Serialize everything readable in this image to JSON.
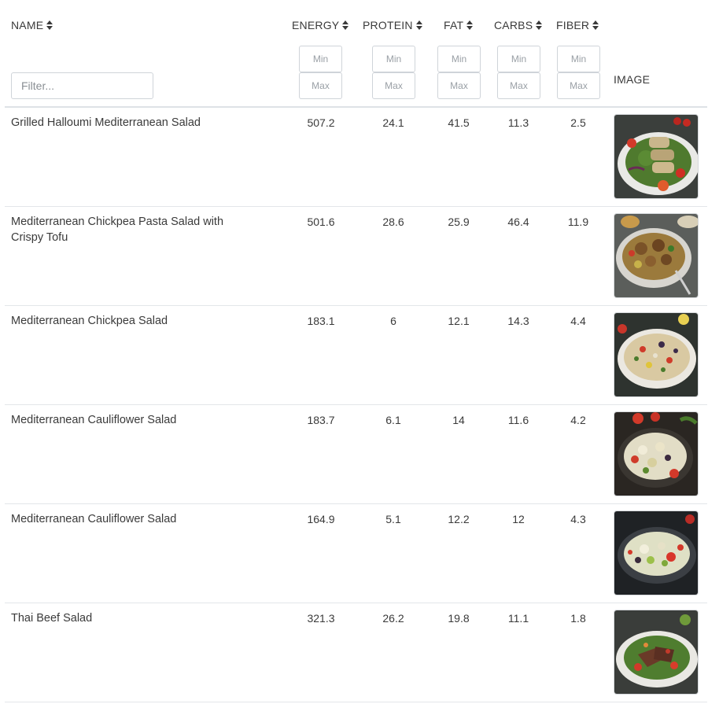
{
  "columns": {
    "name": "NAME",
    "energy": "ENERGY",
    "protein": "PROTEIN",
    "fat": "FAT",
    "carbs": "CARBS",
    "fiber": "FIBER",
    "image": "IMAGE"
  },
  "filter": {
    "placeholder": "Filter...",
    "value": ""
  },
  "range_filters": {
    "min_placeholder": "Min",
    "max_placeholder": "Max"
  },
  "icons": {
    "sort": "sort-up-down-icon"
  },
  "rows": [
    {
      "name": "Grilled Halloumi Mediterranean Salad",
      "energy": "507.2",
      "protein": "24.1",
      "fat": "41.5",
      "carbs": "11.3",
      "fiber": "2.5",
      "image": "salad-photo-halloumi"
    },
    {
      "name": "Mediterranean Chickpea Pasta Salad with Crispy Tofu",
      "energy": "501.6",
      "protein": "28.6",
      "fat": "25.9",
      "carbs": "46.4",
      "fiber": "11.9",
      "image": "salad-photo-chickpea-pasta"
    },
    {
      "name": "Mediterranean Chickpea Salad",
      "energy": "183.1",
      "protein": "6",
      "fat": "12.1",
      "carbs": "14.3",
      "fiber": "4.4",
      "image": "salad-photo-chickpea"
    },
    {
      "name": "Mediterranean Cauliflower Salad",
      "energy": "183.7",
      "protein": "6.1",
      "fat": "14",
      "carbs": "11.6",
      "fiber": "4.2",
      "image": "salad-photo-cauliflower"
    },
    {
      "name": "Mediterranean Cauliflower Salad",
      "energy": "164.9",
      "protein": "5.1",
      "fat": "12.2",
      "carbs": "12",
      "fiber": "4.3",
      "image": "salad-photo-cauliflower"
    },
    {
      "name": "Thai Beef Salad",
      "energy": "321.3",
      "protein": "26.2",
      "fat": "19.8",
      "carbs": "11.1",
      "fiber": "1.8",
      "image": "salad-photo-thai-beef"
    }
  ]
}
